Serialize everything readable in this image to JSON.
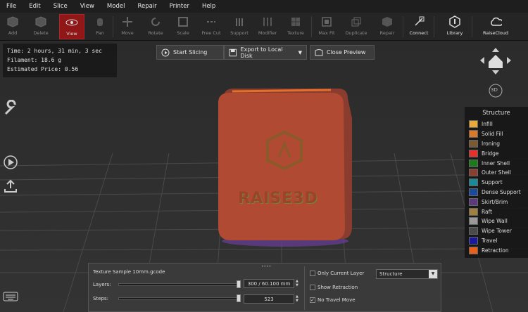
{
  "menu": [
    "File",
    "Edit",
    "Slice",
    "View",
    "Model",
    "Repair",
    "Printer",
    "Help"
  ],
  "toolbar": {
    "add": "Add",
    "delete": "Delete",
    "view": "View",
    "pan": "Pan",
    "move": "Move",
    "rotate": "Rotate",
    "scale": "Scale",
    "free_cut": "Free Cut",
    "support": "Support",
    "modifier": "Modifier",
    "texture": "Texture",
    "max_fit": "Max Fit",
    "duplicate": "Duplicate",
    "repair": "Repair",
    "connect": "Connect",
    "library": "Library",
    "raisecloud": "RaiseCloud"
  },
  "stats": {
    "time": "Time: 2 hours, 31 min, 3 sec",
    "filament": "Filament: 18.6 g",
    "price": "Estimated Price: 0.56"
  },
  "actions": {
    "start": "Start Slicing",
    "export": "Export to Local Disk",
    "close": "Close Preview"
  },
  "model": {
    "logo_text": "RAISE3D"
  },
  "legend": {
    "title": "Structure",
    "items": [
      {
        "label": "Infill",
        "color": "#e8a93a"
      },
      {
        "label": "Solid Fill",
        "color": "#d87a2a"
      },
      {
        "label": "Ironing",
        "color": "#7a5a32"
      },
      {
        "label": "Bridge",
        "color": "#e8302a"
      },
      {
        "label": "Inner Shell",
        "color": "#1c7a1c"
      },
      {
        "label": "Outer Shell",
        "color": "#8a4030"
      },
      {
        "label": "Support",
        "color": "#1a8a96"
      },
      {
        "label": "Dense Support",
        "color": "#1a4a9a"
      },
      {
        "label": "Skirt/Brim",
        "color": "#5a3a7a"
      },
      {
        "label": "Raft",
        "color": "#a08040"
      },
      {
        "label": "Wipe Wall",
        "color": "#9a9a9a"
      },
      {
        "label": "Wipe Tower",
        "color": "#4a4a4a"
      },
      {
        "label": "Travel",
        "color": "#1a1aa0"
      },
      {
        "label": "Retraction",
        "color": "#e8601a"
      }
    ]
  },
  "preview": {
    "file": "Texture Sample 10mm.gcode",
    "layers_label": "Layers:",
    "layers_value": "300 / 60.100 mm",
    "steps_label": "Steps:",
    "steps_value": "523",
    "only_current": "Only Current Layer",
    "show_retraction": "Show Retraction",
    "no_travel": "No Travel Move",
    "structure_select": "Structure",
    "layers_fraction": 1,
    "steps_fraction": 1
  },
  "nav": {
    "view3d": "3D"
  }
}
